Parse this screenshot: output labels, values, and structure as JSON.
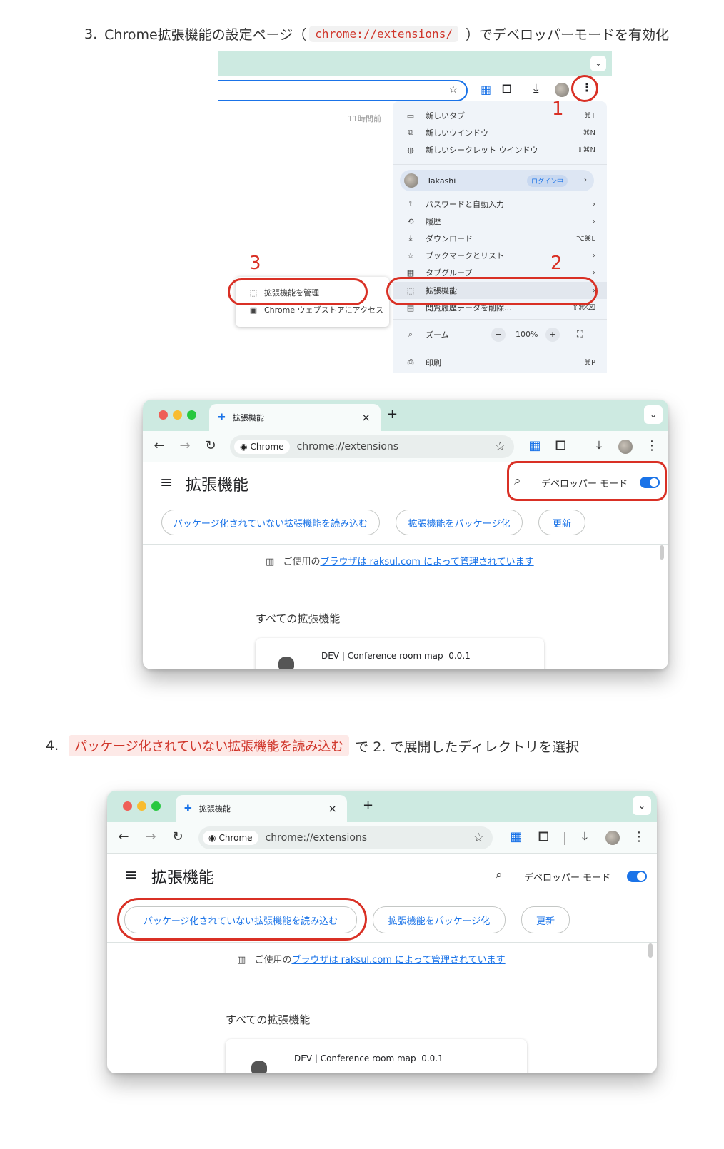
{
  "step3": {
    "number": "3.",
    "text_before": "Chrome拡張機能の設定ページ（",
    "code": "chrome://extensions/",
    "text_after": "）でデベロッパーモードを有効化"
  },
  "menu_screenshot": {
    "history_hint": "11時間前 ",
    "items": [
      {
        "icon": "new-tab-icon",
        "glyph": "▭",
        "label": "新しいタブ",
        "shortcut": "⌘T"
      },
      {
        "icon": "new-window-icon",
        "glyph": "⧉",
        "label": "新しいウインドウ",
        "shortcut": "⌘N"
      },
      {
        "icon": "incognito-icon",
        "glyph": "◍",
        "label": "新しいシークレット ウインドウ",
        "shortcut": "⇧⌘N"
      },
      {
        "icon": "key-icon",
        "glyph": "⚿",
        "label": "パスワードと自動入力",
        "shortcut": "›"
      },
      {
        "icon": "history-icon",
        "glyph": "⟲",
        "label": "履歴",
        "shortcut": "›"
      },
      {
        "icon": "download-icon",
        "glyph": "⤓",
        "label": "ダウンロード",
        "shortcut": "⌥⌘L"
      },
      {
        "icon": "star-icon",
        "glyph": "☆",
        "label": "ブックマークとリスト",
        "shortcut": "›"
      },
      {
        "icon": "tab-group-icon",
        "glyph": "▦",
        "label": "タブグループ",
        "shortcut": "›"
      },
      {
        "icon": "extension-icon",
        "glyph": "⬚",
        "label": "拡張機能",
        "shortcut": "›"
      },
      {
        "icon": "trash-icon",
        "glyph": "▤",
        "label": "閲覧履歴データを削除...",
        "shortcut": "⇧⌘⌫"
      }
    ],
    "profile_name": "Takashi",
    "profile_badge": "ログイン中",
    "zoom_label": "ズーム",
    "zoom_minus": "−",
    "zoom_value": "100%",
    "zoom_plus": "+",
    "print_label": "印刷",
    "print_shortcut": "⌘P",
    "submenu": [
      {
        "glyph": "⬚",
        "label": "拡張機能を管理"
      },
      {
        "glyph": "▣",
        "label": "Chrome ウェブストアにアクセス"
      }
    ],
    "annotations": {
      "one": "1",
      "two": "2",
      "three": "3"
    }
  },
  "browser": {
    "tab_title": "拡張機能",
    "tab_close": "×",
    "new_tab": "+",
    "chip_label": "Chrome",
    "url": "chrome://extensions",
    "page_title": "拡張機能",
    "dev_mode_label": "デベロッパー モード",
    "btn_load_unpacked": "パッケージ化されていない拡張機能を読み込む",
    "btn_pack": "拡張機能をパッケージ化",
    "btn_update": "更新",
    "managed_prefix": "ご使用の",
    "managed_link": "ブラウザは raksul.com によって管理されています",
    "section_title": "すべての拡張機能",
    "extension_name": "DEV | Conference room map  0.0.1"
  },
  "step4": {
    "number": "4.",
    "highlight": "パッケージ化されていない拡張機能を読み込む",
    "text_after": "で 2. で展開したディレクトリを選択"
  },
  "colors": {
    "accent": "#1a73e8",
    "annotation": "#d93025",
    "tab_bar": "#cdeae1"
  }
}
